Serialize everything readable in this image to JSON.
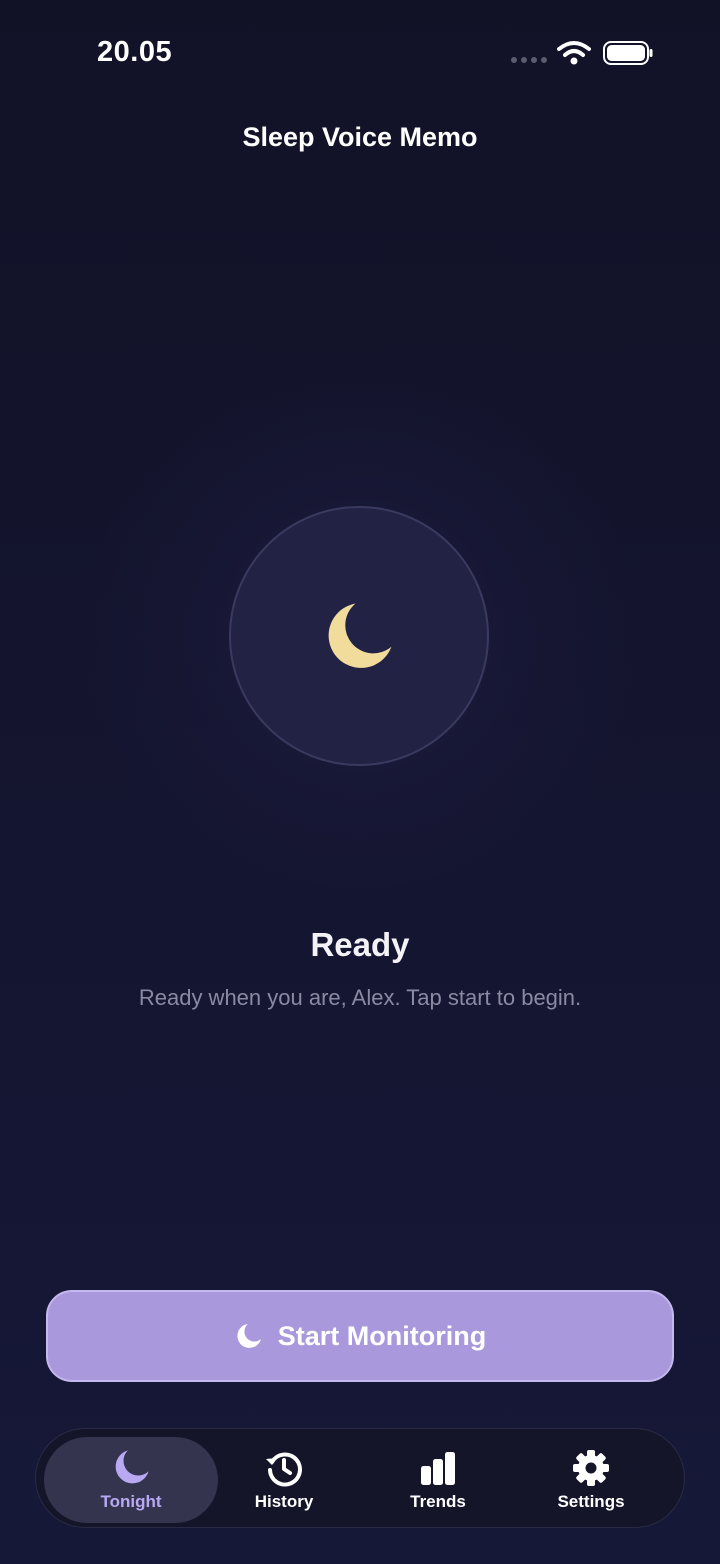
{
  "status_bar": {
    "time": "20.05",
    "icons": [
      "signal-dots-icon",
      "wifi-icon",
      "battery-icon"
    ]
  },
  "header": {
    "title": "Sleep Voice Memo"
  },
  "main": {
    "icon": "moon-icon",
    "status": "Ready",
    "message": "Ready when you are, Alex. Tap start to begin."
  },
  "action": {
    "start_label": "Start Monitoring",
    "icon": "moon-icon"
  },
  "tabs": [
    {
      "label": "Tonight",
      "icon": "moon-icon",
      "active": true
    },
    {
      "label": "History",
      "icon": "history-icon",
      "active": false
    },
    {
      "label": "Trends",
      "icon": "bar-chart-icon",
      "active": false
    },
    {
      "label": "Settings",
      "icon": "gear-icon",
      "active": false
    }
  ],
  "colors": {
    "background": "#121228",
    "accent": "#a999dc",
    "active_tab_label": "#b9a9f2",
    "moon": "#f2dc9c"
  }
}
